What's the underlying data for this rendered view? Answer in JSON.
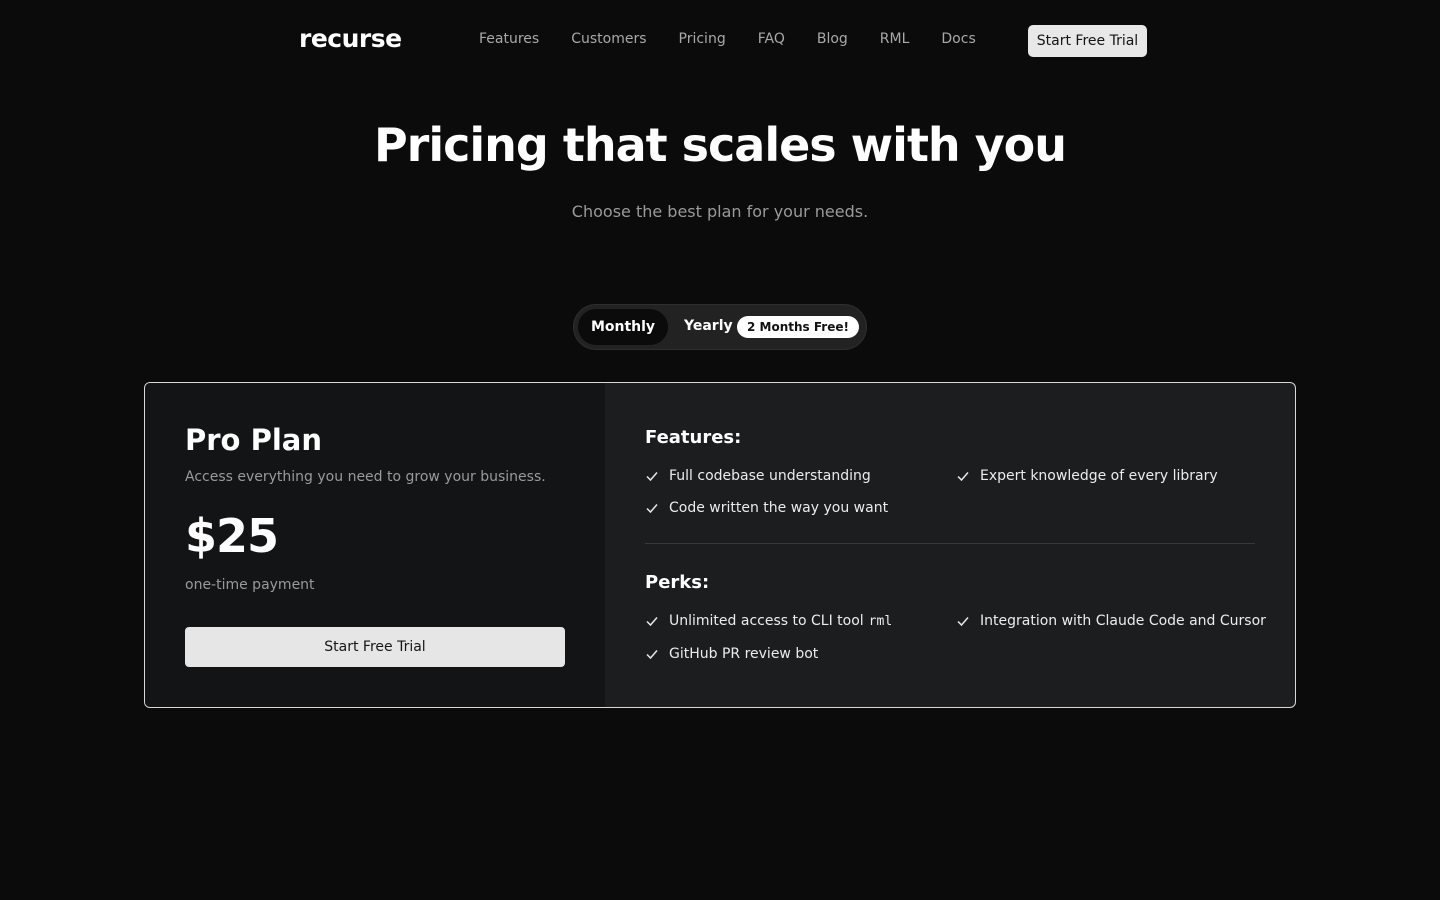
{
  "header": {
    "logo": "recurse",
    "nav": [
      "Features",
      "Customers",
      "Pricing",
      "FAQ",
      "Blog",
      "RML",
      "Docs"
    ],
    "cta_label": "Start Free Trial"
  },
  "hero": {
    "title": "Pricing that scales with you",
    "subtitle": "Choose the best plan for your needs."
  },
  "billing_toggle": {
    "monthly_label": "Monthly",
    "yearly_label": "Yearly",
    "badge": "2 Months Free!",
    "selected": "Monthly"
  },
  "plan": {
    "name": "Pro Plan",
    "description": "Access everything you need to grow your business.",
    "price": "$25",
    "price_note": "one-time payment",
    "cta_label": "Start Free Trial"
  },
  "features": {
    "title": "Features:",
    "items": [
      "Full codebase understanding",
      "Expert knowledge of every library",
      "Code written the way you want"
    ]
  },
  "perks": {
    "title": "Perks:",
    "item_cli_text": "Unlimited access to CLI tool",
    "item_cli_code": "rml",
    "item_integration": "Integration with Claude Code and Cursor",
    "item_bot": "GitHub PR review bot"
  },
  "icons": {
    "check": "check-icon"
  },
  "colors": {
    "background": "#0b0b0b",
    "card_left": "#131415",
    "card_right": "#1c1d1e",
    "button": "#e6e6e6"
  }
}
